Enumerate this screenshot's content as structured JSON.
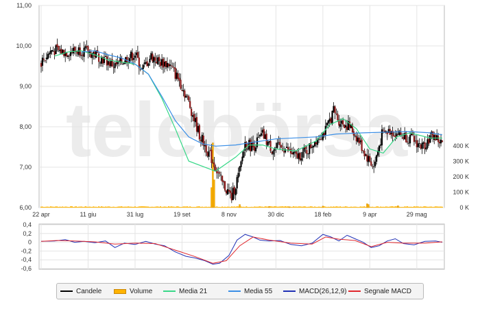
{
  "watermark": "telebörsa",
  "colors": {
    "candle": "#000000",
    "candle_down": "#8b1a1a",
    "volume": "#ffb400",
    "volume_border": "#c98500",
    "media21": "#38d888",
    "media55": "#3a8ee6",
    "macd": "#1f2fb5",
    "signal": "#e0262c",
    "grid": "#e4e4e4",
    "frame": "#b8b8b8"
  },
  "legend": [
    {
      "label": "Candele",
      "color": "#000000",
      "kind": "line"
    },
    {
      "label": "Volume",
      "color": "#ffb400",
      "kind": "box"
    },
    {
      "label": "Media 21",
      "color": "#38d888",
      "kind": "line"
    },
    {
      "label": "Media 55",
      "color": "#3a8ee6",
      "kind": "line"
    },
    {
      "label": "MACD(26,12,9)",
      "color": "#1f2fb5",
      "kind": "line"
    },
    {
      "label": "Segnale MACD",
      "color": "#e0262c",
      "kind": "line"
    }
  ],
  "chart_data": [
    {
      "type": "candlestick",
      "panel": "price",
      "x_ticks": [
        "22 apr",
        "11 giu",
        "31 lug",
        "19 set",
        "8 nov",
        "30 dic",
        "18 feb",
        "9 apr",
        "29 mag"
      ],
      "y_ticks": [
        "11,00",
        "10,00",
        "9,00",
        "8,00",
        "7,00",
        "6,00"
      ],
      "ylim": [
        6.0,
        11.0
      ],
      "y_tick_values": [
        11,
        10,
        9,
        8,
        7,
        6
      ],
      "trading_days": 300,
      "x_tick_index": [
        0,
        35,
        70,
        105,
        140,
        175,
        210,
        245,
        280
      ],
      "close_anchors": [
        [
          0,
          9.6
        ],
        [
          8,
          9.9
        ],
        [
          18,
          9.85
        ],
        [
          30,
          9.9
        ],
        [
          40,
          9.8
        ],
        [
          55,
          9.5
        ],
        [
          62,
          9.65
        ],
        [
          70,
          9.8
        ],
        [
          75,
          9.4
        ],
        [
          82,
          9.75
        ],
        [
          88,
          9.6
        ],
        [
          95,
          9.55
        ],
        [
          103,
          9.15
        ],
        [
          110,
          8.6
        ],
        [
          118,
          7.8
        ],
        [
          128,
          7.15
        ],
        [
          135,
          6.6
        ],
        [
          142,
          6.25
        ],
        [
          148,
          6.9
        ],
        [
          152,
          7.6
        ],
        [
          158,
          7.5
        ],
        [
          165,
          7.8
        ],
        [
          172,
          7.45
        ],
        [
          180,
          7.5
        ],
        [
          190,
          7.25
        ],
        [
          198,
          7.4
        ],
        [
          205,
          7.7
        ],
        [
          212,
          7.9
        ],
        [
          218,
          8.4
        ],
        [
          222,
          8.15
        ],
        [
          230,
          8.0
        ],
        [
          236,
          7.7
        ],
        [
          242,
          7.3
        ],
        [
          248,
          7.0
        ],
        [
          254,
          7.8
        ],
        [
          260,
          7.9
        ],
        [
          268,
          7.8
        ],
        [
          276,
          7.7
        ],
        [
          284,
          7.5
        ],
        [
          292,
          7.8
        ],
        [
          298,
          7.6
        ]
      ],
      "series": [
        {
          "name": "Media 21",
          "values": [
            9.75,
            9.85,
            9.88,
            9.78,
            9.65,
            9.6,
            9.55,
            9.3,
            8.7,
            7.95,
            7.15,
            6.9,
            7.25,
            7.55,
            7.55,
            7.45,
            7.4,
            7.65,
            8.05,
            8.2,
            7.95,
            7.45,
            7.35,
            7.75,
            7.85,
            7.72,
            7.72
          ],
          "x_index": [
            10,
            20,
            30,
            40,
            50,
            60,
            70,
            80,
            90,
            100,
            110,
            130,
            145,
            155,
            165,
            175,
            190,
            205,
            215,
            225,
            235,
            245,
            255,
            265,
            275,
            290,
            299
          ]
        },
        {
          "name": "Media 55",
          "values": [
            9.85,
            9.88,
            9.78,
            9.7,
            9.55,
            9.3,
            8.75,
            8.15,
            7.75,
            7.58,
            7.52,
            7.55,
            7.7,
            7.75,
            7.82,
            7.85,
            7.87,
            7.88,
            7.85,
            7.8
          ],
          "x_index": [
            30,
            40,
            50,
            60,
            70,
            80,
            90,
            100,
            110,
            120,
            130,
            145,
            175,
            205,
            220,
            240,
            260,
            275,
            290,
            299
          ]
        }
      ]
    },
    {
      "type": "bar",
      "panel": "volume",
      "name": "Volume",
      "y_ticks": [
        "400 K",
        "300 K",
        "200 K",
        "100 K",
        "0 K"
      ],
      "ylim": [
        0,
        400
      ],
      "y_tick_values": [
        400,
        300,
        200,
        100,
        0
      ],
      "spikes": [
        [
          127,
          130
        ],
        [
          128,
          420
        ],
        [
          129,
          180
        ],
        [
          148,
          20
        ],
        [
          170,
          8
        ],
        [
          185,
          6
        ],
        [
          210,
          10
        ],
        [
          243,
          25
        ],
        [
          244,
          20
        ],
        [
          266,
          12
        ]
      ],
      "baseline": 6
    },
    {
      "type": "line",
      "panel": "macd",
      "y_ticks": [
        "0,4",
        "0,2",
        "0",
        "-0,2",
        "-0,4",
        "-0,6"
      ],
      "ylim": [
        -0.6,
        0.4
      ],
      "y_tick_values": [
        0.4,
        0.2,
        0.0,
        -0.2,
        -0.4,
        -0.6
      ],
      "series": [
        {
          "name": "MACD(26,12,9)",
          "x_index": [
            0,
            10,
            18,
            25,
            32,
            40,
            48,
            55,
            62,
            70,
            78,
            85,
            92,
            100,
            108,
            115,
            122,
            128,
            133,
            140,
            146,
            152,
            158,
            163,
            170,
            178,
            186,
            194,
            202,
            210,
            216,
            222,
            228,
            234,
            240,
            246,
            252,
            258,
            264,
            270,
            278,
            286,
            294,
            299
          ],
          "values": [
            0.02,
            0.03,
            0.06,
            0.0,
            0.02,
            -0.01,
            0.03,
            -0.12,
            -0.02,
            -0.05,
            0.02,
            -0.04,
            -0.08,
            -0.22,
            -0.32,
            -0.36,
            -0.42,
            -0.5,
            -0.48,
            -0.3,
            0.05,
            0.18,
            0.12,
            0.05,
            0.03,
            0.04,
            -0.05,
            -0.08,
            -0.02,
            0.18,
            0.12,
            0.03,
            0.16,
            0.08,
            0.0,
            -0.12,
            -0.08,
            0.03,
            0.08,
            -0.03,
            -0.06,
            0.02,
            0.03,
            0.0
          ]
        },
        {
          "name": "Segnale MACD",
          "x_index": [
            0,
            12,
            25,
            40,
            55,
            70,
            85,
            100,
            115,
            128,
            138,
            148,
            158,
            170,
            186,
            202,
            212,
            222,
            234,
            246,
            258,
            270,
            286,
            299
          ],
          "values": [
            0.02,
            0.04,
            0.03,
            0.01,
            -0.04,
            -0.02,
            -0.03,
            -0.18,
            -0.33,
            -0.48,
            -0.42,
            -0.08,
            0.12,
            0.05,
            -0.02,
            -0.04,
            0.12,
            0.07,
            0.04,
            -0.1,
            0.0,
            -0.02,
            -0.02,
            0.01
          ]
        }
      ]
    }
  ]
}
